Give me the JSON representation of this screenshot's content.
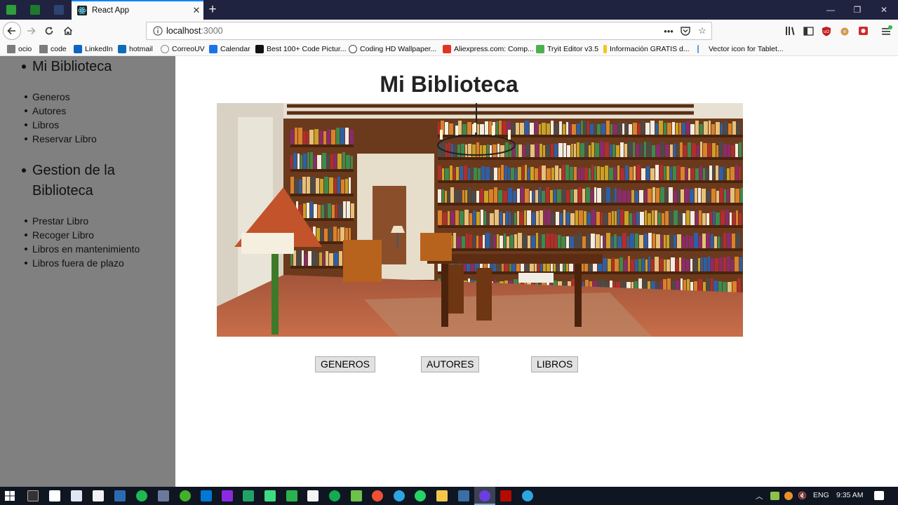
{
  "browser": {
    "tab_title": "React App",
    "url_host": "localhost",
    "url_port": ":3000",
    "bookmarks": [
      {
        "label": "ocio",
        "icon": "folder-icon"
      },
      {
        "label": "code",
        "icon": "folder-icon"
      },
      {
        "label": "LinkedIn",
        "icon": "linkedin-icon"
      },
      {
        "label": "hotmail",
        "icon": "outlook-icon"
      },
      {
        "label": "CorreoUV",
        "icon": "leaf-icon"
      },
      {
        "label": "Calendar",
        "icon": "calendar-icon"
      },
      {
        "label": "Best 100+ Code Pictur...",
        "icon": "camera-icon"
      },
      {
        "label": "Coding HD Wallpaper...",
        "icon": "globe-icon"
      },
      {
        "label": "Aliexpress.com: Comp...",
        "icon": "aliexpress-icon"
      },
      {
        "label": "Tryit Editor v3.5",
        "icon": "w3schools-icon"
      },
      {
        "label": "Información GRATIS d...",
        "icon": "candle-icon"
      },
      {
        "label": "Vector icon for Tablet...",
        "icon": "pin-icon"
      }
    ]
  },
  "sidebar": {
    "section1_title": "Mi Biblioteca",
    "section1_items": [
      "Generos",
      "Autores",
      "Libros",
      "Reservar Libro"
    ],
    "section2_title_line1": "Gestion de la",
    "section2_title_line2": "Biblioteca",
    "section2_items": [
      "Prestar Libro",
      "Recoger Libro",
      "Libros en mantenimiento",
      "Libros fuera de plazo"
    ]
  },
  "main": {
    "title": "Mi Biblioteca",
    "buttons": [
      "GENEROS",
      "AUTORES",
      "LIBROS"
    ]
  },
  "taskbar": {
    "lang": "ENG",
    "time": "9:35 AM"
  },
  "colors": {
    "sidebar_bg": "#808080",
    "tabbar_bg": "#202340",
    "accent": "#0a84ff"
  }
}
